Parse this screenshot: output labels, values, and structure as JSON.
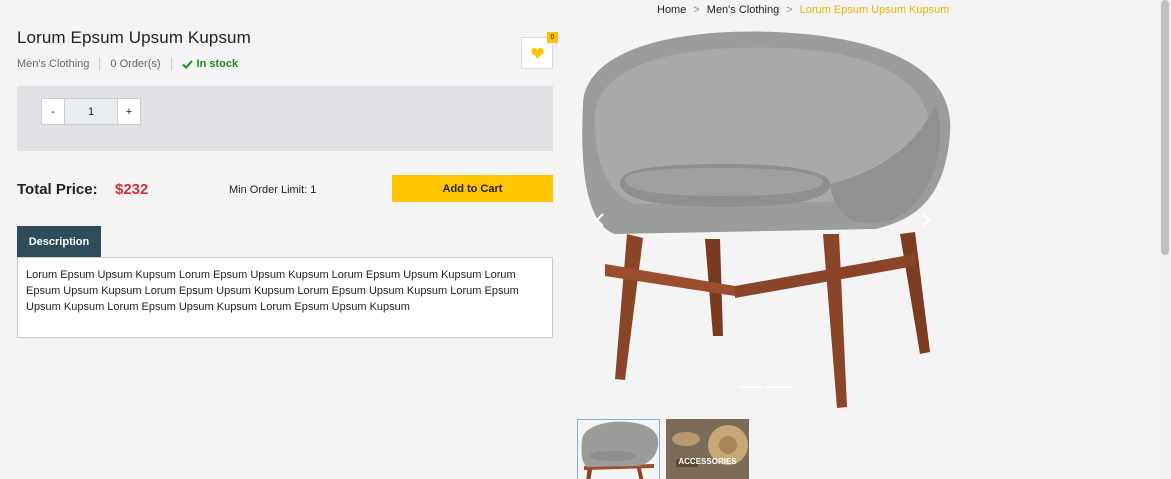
{
  "breadcrumb": {
    "items": [
      "Home",
      "Men's Clothing"
    ],
    "current": "Lorum Epsum Upsum Kupsum"
  },
  "product": {
    "title": "Lorum Epsum Upsum Kupsum",
    "category": "Men's Clothing",
    "orders": "0 Order(s)",
    "stock": "In stock"
  },
  "wishlist": {
    "count": "0",
    "icon": "heart-icon"
  },
  "quantity": {
    "minus": "-",
    "value": "1",
    "plus": "+"
  },
  "price": {
    "label": "Total Price:",
    "value": "$232",
    "min_order": "Min Order Limit: 1",
    "cart_label": "Add to Cart"
  },
  "tabs": {
    "description": "Description"
  },
  "description": "Lorum Epsum Upsum Kupsum Lorum Epsum Upsum Kupsum Lorum Epsum Upsum Kupsum Lorum Epsum Upsum Kupsum Lorum Epsum Upsum Kupsum Lorum Epsum Upsum Kupsum Lorum Epsum Upsum Kupsum Lorum Epsum Upsum Kupsum Lorum Epsum Upsum Kupsum",
  "thumbnails": [
    {
      "label": ""
    },
    {
      "label": "ACCESSORIES"
    }
  ],
  "colors": {
    "accent": "#ffc600",
    "price": "#d32f2f",
    "tab": "#2f4c5a",
    "stock": "#1e8a1e"
  }
}
